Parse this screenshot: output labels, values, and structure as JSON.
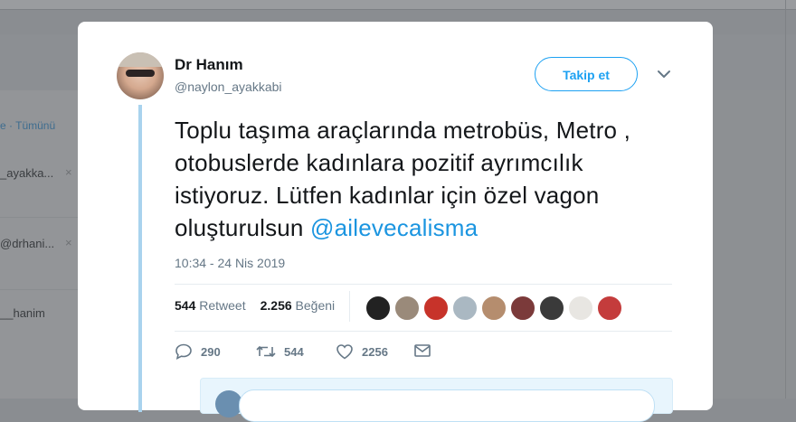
{
  "background": {
    "filter_link": "e · Tümünü",
    "items": [
      {
        "label": "_ayakka...",
        "close": "×"
      },
      {
        "label": "@drhani...",
        "close": "×"
      },
      {
        "label": "__hanim",
        "close": ""
      }
    ]
  },
  "tweet": {
    "author_name": "Dr Hanım",
    "author_handle": "@naylon_ayakkabi",
    "follow_label": "Takip et",
    "text": "Toplu taşıma araçlarında metrobüs, Metro , otobuslerde kadınlara pozitif ayrımcılık istiyoruz. Lütfen kadınlar için özel vagon oluşturulsun ",
    "mention": "@ailevecalisma",
    "timestamp": "10:34 - 24 Nis 2019",
    "retweet_count": "544",
    "retweet_label": "Retweet",
    "like_count": "2.256",
    "like_label": "Beğeni",
    "actions": {
      "reply_count": "290",
      "retweet_count": "544",
      "like_count": "2256"
    }
  },
  "colors": {
    "accent": "#1da1f2",
    "mention": "#1b95e0",
    "secondary_text": "#657786",
    "thread_line": "#a9d3ee"
  },
  "icons": {
    "more": "chevron-down-icon",
    "reply": "reply-icon",
    "retweet": "retweet-icon",
    "like": "heart-icon",
    "dm": "envelope-icon"
  }
}
